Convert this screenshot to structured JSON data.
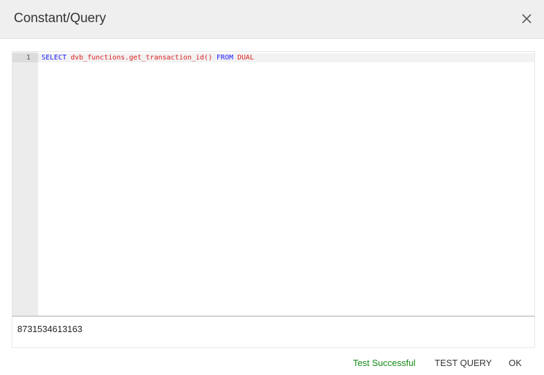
{
  "dialog": {
    "title": "Constant/Query",
    "close_icon": "close-icon"
  },
  "editor": {
    "lines": [
      {
        "number": "1",
        "tokens": {
          "kw_select": "SELECT",
          "ident_func": "dvb_functions.get_transaction_id()",
          "kw_from": "FROM",
          "ident_table": "DUAL"
        }
      }
    ],
    "colors": {
      "keyword": "#1a1aff",
      "identifier": "#e01e1e",
      "gutter": "#ececec"
    }
  },
  "result": {
    "value": "8731534613163"
  },
  "footer": {
    "status": "Test Successful",
    "status_color": "#138a13",
    "test_query_label": "TEST QUERY",
    "ok_label": "OK"
  }
}
